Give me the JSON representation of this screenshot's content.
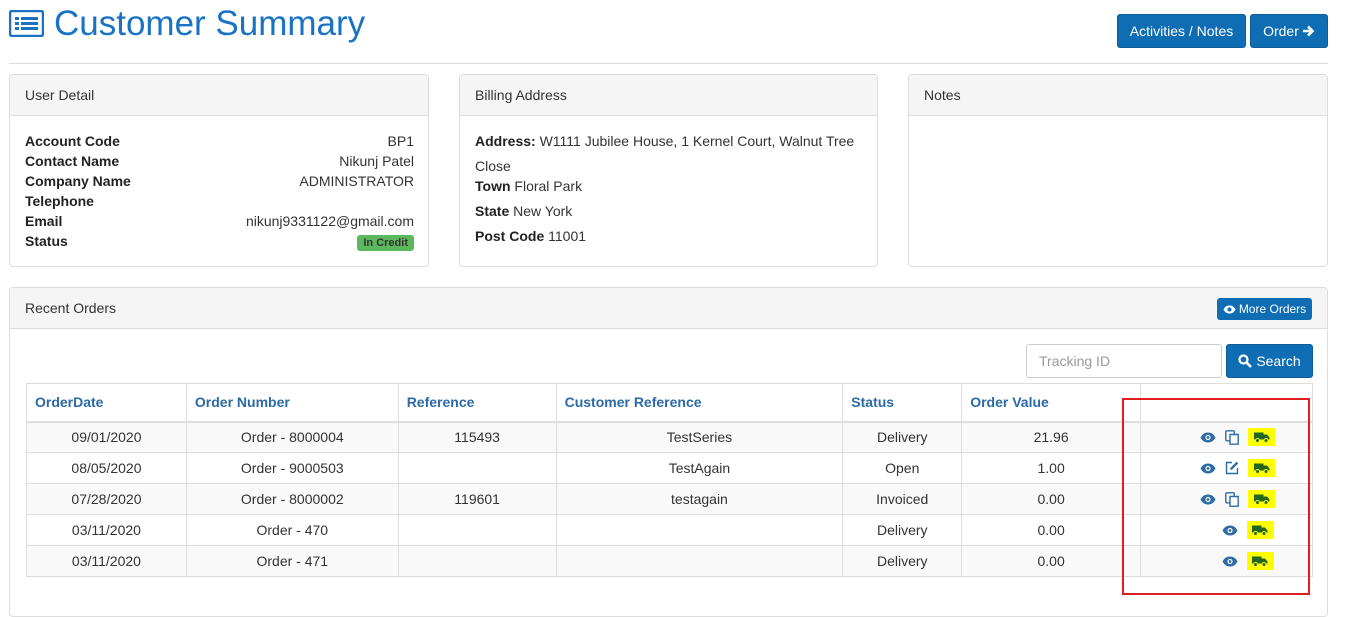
{
  "page": {
    "title": "Customer Summary"
  },
  "toolbar": {
    "activities_label": "Activities / Notes",
    "order_label": "Order"
  },
  "user_detail": {
    "heading": "User Detail",
    "rows": [
      {
        "label": "Account Code",
        "value": "BP1"
      },
      {
        "label": "Contact Name",
        "value": "Nikunj Patel"
      },
      {
        "label": "Company Name",
        "value": "ADMINISTRATOR"
      },
      {
        "label": "Telephone",
        "value": ""
      },
      {
        "label": "Email",
        "value": "nikunj9331122@gmail.com"
      },
      {
        "label": "Status",
        "value": "In Credit"
      }
    ]
  },
  "billing": {
    "heading": "Billing Address",
    "address_label": "Address:",
    "address_line1": "W1111 Jubilee House, 1 Kernel Court, Walnut Tree",
    "address_line2": "Close",
    "town_label": "Town",
    "town": "Floral Park",
    "state_label": "State",
    "state": "New York",
    "postcode_label": "Post Code",
    "postcode": "11001"
  },
  "notes": {
    "heading": "Notes"
  },
  "orders": {
    "heading": "Recent Orders",
    "more_label": "More Orders",
    "search_placeholder": "Tracking ID",
    "search_label": "Search",
    "columns": [
      "OrderDate",
      "Order Number",
      "Reference",
      "Customer Reference",
      "Status",
      "Order Value"
    ],
    "rows": [
      {
        "date": "09/01/2020",
        "number": "Order - 8000004",
        "reference": "115493",
        "customer_ref": "TestSeries",
        "status": "Delivery",
        "value": "21.96",
        "actions": [
          "eye-icon",
          "copy-icon",
          "truck-icon"
        ]
      },
      {
        "date": "08/05/2020",
        "number": "Order - 9000503",
        "reference": "",
        "customer_ref": "TestAgain",
        "status": "Open",
        "value": "1.00",
        "actions": [
          "eye-icon",
          "edit-icon",
          "truck-icon"
        ]
      },
      {
        "date": "07/28/2020",
        "number": "Order - 8000002",
        "reference": "119601",
        "customer_ref": "testagain",
        "status": "Invoiced",
        "value": "0.00",
        "actions": [
          "eye-icon",
          "copy-icon",
          "truck-icon"
        ]
      },
      {
        "date": "03/11/2020",
        "number": "Order - 470",
        "reference": "",
        "customer_ref": "",
        "status": "Delivery",
        "value": "0.00",
        "actions": [
          "eye-icon",
          "truck-icon"
        ]
      },
      {
        "date": "03/11/2020",
        "number": "Order - 471",
        "reference": "",
        "customer_ref": "",
        "status": "Delivery",
        "value": "0.00",
        "actions": [
          "eye-icon",
          "truck-icon"
        ]
      }
    ]
  },
  "colors": {
    "primary": "#0f6db4",
    "title": "#1a73c2",
    "status_badge": "#5cb85c",
    "highlight": "#ffff00",
    "annotation": "#e01e1e"
  }
}
